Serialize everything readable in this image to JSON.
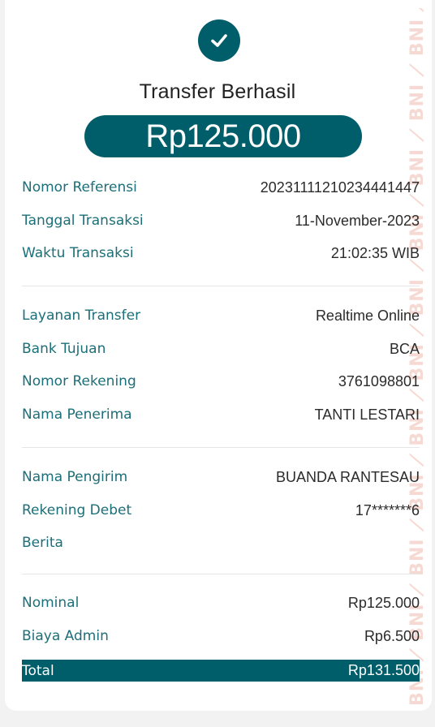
{
  "header": {
    "title": "Transfer Berhasil",
    "amount": "Rp125.000",
    "status_icon": "check-icon"
  },
  "watermark": {
    "text": "BNI ⟋ BNI ⟋ BNI ⟋ BNI ⟋ BNI ⟋ BNI ⟋ BNI ⟋ BNI ⟋ BNI ⟋ BNI ⟋ BNI ⟋ BNI ⟋ BNI ⟋ BNI ⟋ BNI ⟋ BNI ⟋ BNI ⟋ BNI ⟋ BNI ⟋ BNI"
  },
  "section1": {
    "reference": {
      "label": "Nomor Referensi",
      "value": "20231111210234441447"
    },
    "date": {
      "label": "Tanggal Transaksi",
      "value": "11-November-2023"
    },
    "time": {
      "label": "Waktu Transaksi",
      "value": "21:02:35 WIB"
    }
  },
  "section2": {
    "service": {
      "label": "Layanan Transfer",
      "value": "Realtime Online"
    },
    "bank": {
      "label": "Bank Tujuan",
      "value": "BCA"
    },
    "account": {
      "label": "Nomor Rekening",
      "value": "3761098801"
    },
    "recipient": {
      "label": "Nama Penerima",
      "value": "TANTI LESTARI"
    }
  },
  "section3": {
    "sender": {
      "label": "Nama Pengirim",
      "value": "BUANDA RANTESAU"
    },
    "debit_account": {
      "label": "Rekening Debet",
      "value": "17*******6"
    },
    "message": {
      "label": "Berita",
      "value": ""
    }
  },
  "section4": {
    "nominal": {
      "label": "Nominal",
      "value": "Rp125.000"
    },
    "admin_fee": {
      "label": "Biaya Admin",
      "value": "Rp6.500"
    },
    "total": {
      "label": "Total",
      "value": "Rp131.500"
    }
  },
  "colors": {
    "accent": "#005e6a",
    "label": "#1c6f78",
    "watermark": "#e07a5f"
  }
}
